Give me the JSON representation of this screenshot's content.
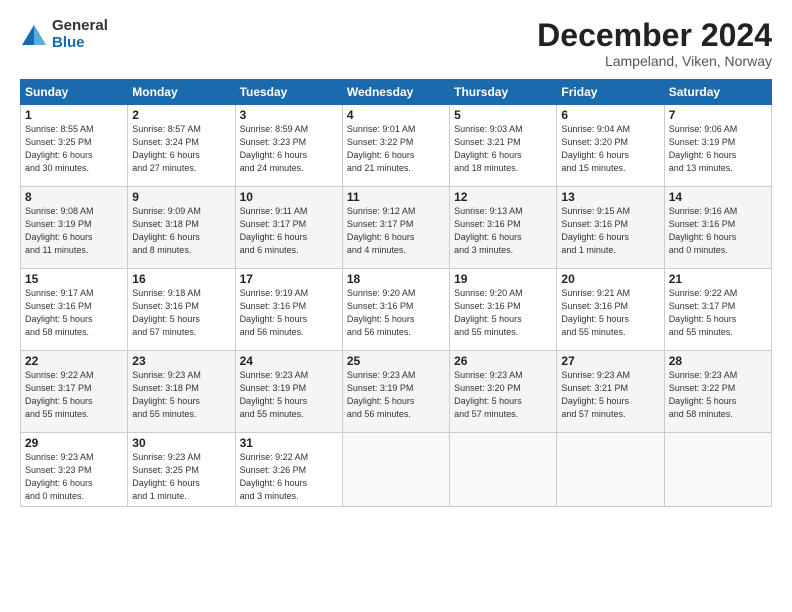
{
  "header": {
    "logo_general": "General",
    "logo_blue": "Blue",
    "month": "December 2024",
    "location": "Lampeland, Viken, Norway"
  },
  "weekdays": [
    "Sunday",
    "Monday",
    "Tuesday",
    "Wednesday",
    "Thursday",
    "Friday",
    "Saturday"
  ],
  "weeks": [
    [
      {
        "day": "1",
        "info": "Sunrise: 8:55 AM\nSunset: 3:25 PM\nDaylight: 6 hours\nand 30 minutes."
      },
      {
        "day": "2",
        "info": "Sunrise: 8:57 AM\nSunset: 3:24 PM\nDaylight: 6 hours\nand 27 minutes."
      },
      {
        "day": "3",
        "info": "Sunrise: 8:59 AM\nSunset: 3:23 PM\nDaylight: 6 hours\nand 24 minutes."
      },
      {
        "day": "4",
        "info": "Sunrise: 9:01 AM\nSunset: 3:22 PM\nDaylight: 6 hours\nand 21 minutes."
      },
      {
        "day": "5",
        "info": "Sunrise: 9:03 AM\nSunset: 3:21 PM\nDaylight: 6 hours\nand 18 minutes."
      },
      {
        "day": "6",
        "info": "Sunrise: 9:04 AM\nSunset: 3:20 PM\nDaylight: 6 hours\nand 15 minutes."
      },
      {
        "day": "7",
        "info": "Sunrise: 9:06 AM\nSunset: 3:19 PM\nDaylight: 6 hours\nand 13 minutes."
      }
    ],
    [
      {
        "day": "8",
        "info": "Sunrise: 9:08 AM\nSunset: 3:19 PM\nDaylight: 6 hours\nand 11 minutes."
      },
      {
        "day": "9",
        "info": "Sunrise: 9:09 AM\nSunset: 3:18 PM\nDaylight: 6 hours\nand 8 minutes."
      },
      {
        "day": "10",
        "info": "Sunrise: 9:11 AM\nSunset: 3:17 PM\nDaylight: 6 hours\nand 6 minutes."
      },
      {
        "day": "11",
        "info": "Sunrise: 9:12 AM\nSunset: 3:17 PM\nDaylight: 6 hours\nand 4 minutes."
      },
      {
        "day": "12",
        "info": "Sunrise: 9:13 AM\nSunset: 3:16 PM\nDaylight: 6 hours\nand 3 minutes."
      },
      {
        "day": "13",
        "info": "Sunrise: 9:15 AM\nSunset: 3:16 PM\nDaylight: 6 hours\nand 1 minute."
      },
      {
        "day": "14",
        "info": "Sunrise: 9:16 AM\nSunset: 3:16 PM\nDaylight: 6 hours\nand 0 minutes."
      }
    ],
    [
      {
        "day": "15",
        "info": "Sunrise: 9:17 AM\nSunset: 3:16 PM\nDaylight: 5 hours\nand 58 minutes."
      },
      {
        "day": "16",
        "info": "Sunrise: 9:18 AM\nSunset: 3:16 PM\nDaylight: 5 hours\nand 57 minutes."
      },
      {
        "day": "17",
        "info": "Sunrise: 9:19 AM\nSunset: 3:16 PM\nDaylight: 5 hours\nand 56 minutes."
      },
      {
        "day": "18",
        "info": "Sunrise: 9:20 AM\nSunset: 3:16 PM\nDaylight: 5 hours\nand 56 minutes."
      },
      {
        "day": "19",
        "info": "Sunrise: 9:20 AM\nSunset: 3:16 PM\nDaylight: 5 hours\nand 55 minutes."
      },
      {
        "day": "20",
        "info": "Sunrise: 9:21 AM\nSunset: 3:16 PM\nDaylight: 5 hours\nand 55 minutes."
      },
      {
        "day": "21",
        "info": "Sunrise: 9:22 AM\nSunset: 3:17 PM\nDaylight: 5 hours\nand 55 minutes."
      }
    ],
    [
      {
        "day": "22",
        "info": "Sunrise: 9:22 AM\nSunset: 3:17 PM\nDaylight: 5 hours\nand 55 minutes."
      },
      {
        "day": "23",
        "info": "Sunrise: 9:23 AM\nSunset: 3:18 PM\nDaylight: 5 hours\nand 55 minutes."
      },
      {
        "day": "24",
        "info": "Sunrise: 9:23 AM\nSunset: 3:19 PM\nDaylight: 5 hours\nand 55 minutes."
      },
      {
        "day": "25",
        "info": "Sunrise: 9:23 AM\nSunset: 3:19 PM\nDaylight: 5 hours\nand 56 minutes."
      },
      {
        "day": "26",
        "info": "Sunrise: 9:23 AM\nSunset: 3:20 PM\nDaylight: 5 hours\nand 57 minutes."
      },
      {
        "day": "27",
        "info": "Sunrise: 9:23 AM\nSunset: 3:21 PM\nDaylight: 5 hours\nand 57 minutes."
      },
      {
        "day": "28",
        "info": "Sunrise: 9:23 AM\nSunset: 3:22 PM\nDaylight: 5 hours\nand 58 minutes."
      }
    ],
    [
      {
        "day": "29",
        "info": "Sunrise: 9:23 AM\nSunset: 3:23 PM\nDaylight: 6 hours\nand 0 minutes."
      },
      {
        "day": "30",
        "info": "Sunrise: 9:23 AM\nSunset: 3:25 PM\nDaylight: 6 hours\nand 1 minute."
      },
      {
        "day": "31",
        "info": "Sunrise: 9:22 AM\nSunset: 3:26 PM\nDaylight: 6 hours\nand 3 minutes."
      },
      {
        "day": "",
        "info": ""
      },
      {
        "day": "",
        "info": ""
      },
      {
        "day": "",
        "info": ""
      },
      {
        "day": "",
        "info": ""
      }
    ]
  ]
}
